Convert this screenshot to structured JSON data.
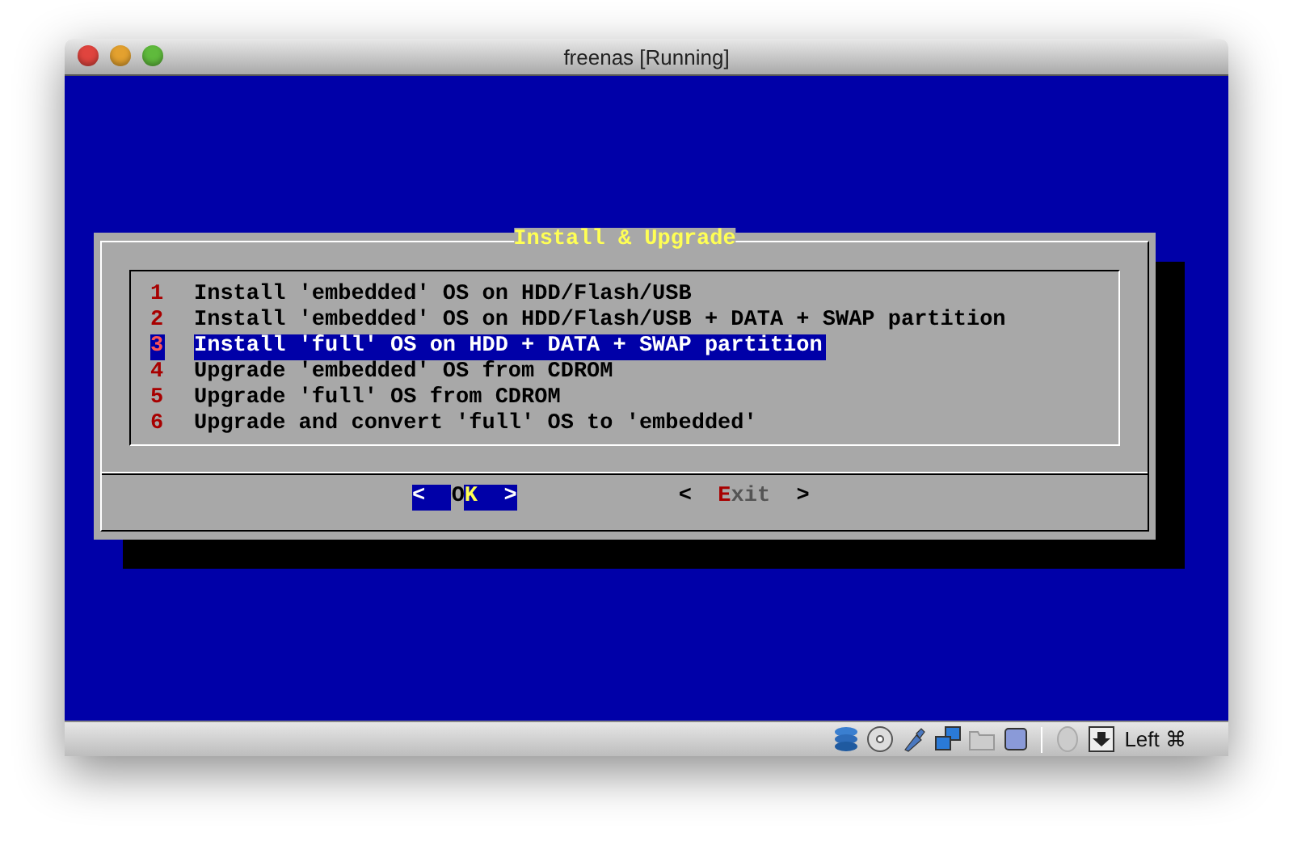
{
  "window": {
    "title": "freenas [Running]"
  },
  "dialog": {
    "title": "Install & Upgrade",
    "items": [
      {
        "key": "1",
        "label": "Install 'embedded' OS on HDD/Flash/USB",
        "selected": false
      },
      {
        "key": "2",
        "label": "Install 'embedded' OS on HDD/Flash/USB + DATA + SWAP partition",
        "selected": false
      },
      {
        "key": "3",
        "label": "Install 'full' OS on HDD + DATA + SWAP partition",
        "selected": true
      },
      {
        "key": "4",
        "label": "Upgrade 'embedded' OS from CDROM",
        "selected": false
      },
      {
        "key": "5",
        "label": "Upgrade 'full' OS from CDROM",
        "selected": false
      },
      {
        "key": "6",
        "label": "Upgrade and convert 'full' OS to 'embedded'",
        "selected": false
      }
    ],
    "buttons": [
      {
        "left": "<",
        "label": "OK",
        "right": ">",
        "selected": true
      },
      {
        "left": "<",
        "label": "Exit",
        "right": ">",
        "selected": false
      }
    ]
  },
  "status_bar": {
    "keyboard": "Left ⌘"
  }
}
